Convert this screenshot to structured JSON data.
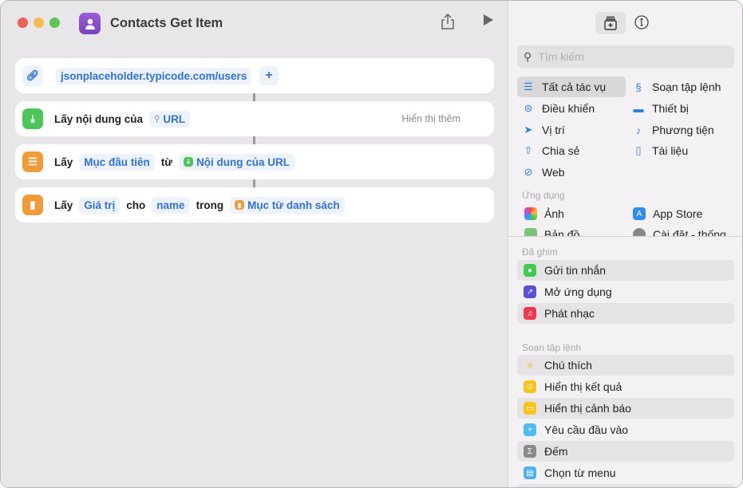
{
  "window": {
    "title": "Contacts Get Item"
  },
  "actions": [
    {
      "url": "jsonplaceholder.typicode.com/users",
      "add": "+"
    },
    {
      "label": "Lấy nội dung của",
      "token": "URL",
      "more": "Hiển thị thêm"
    },
    {
      "label": "Lấy",
      "token1": "Mục đầu tiên",
      "word": "từ",
      "token2": "Nội dung của URL"
    },
    {
      "label": "Lấy",
      "token1": "Giá trị",
      "word1": "cho",
      "token2": "name",
      "word2": "trong",
      "token3": "Mục từ danh sách"
    }
  ],
  "sidebar": {
    "search_placeholder": "Tìm kiếm",
    "categories": [
      "Tất cả tác vụ",
      "Soạn tập lệnh",
      "Điều khiển",
      "Thiết bị",
      "Vị trí",
      "Phương tiện",
      "Chia sẻ",
      "Tài liệu",
      "Web"
    ],
    "apps_header": "Ứng dụng",
    "apps": [
      "Ảnh",
      "App Store",
      "Bản đồ",
      "Cài đặt - thống"
    ],
    "pinned_header": "Đã ghim",
    "pinned": [
      "Gửi tin nhắn",
      "Mở ứng dụng",
      "Phát nhạc"
    ],
    "scripting_header": "Soạn tập lệnh",
    "scripting": [
      "Chú thích",
      "Hiển thị kết quả",
      "Hiển thị cảnh báo",
      "Yêu cầu đầu vào",
      "Đếm",
      "Chọn từ menu"
    ]
  }
}
